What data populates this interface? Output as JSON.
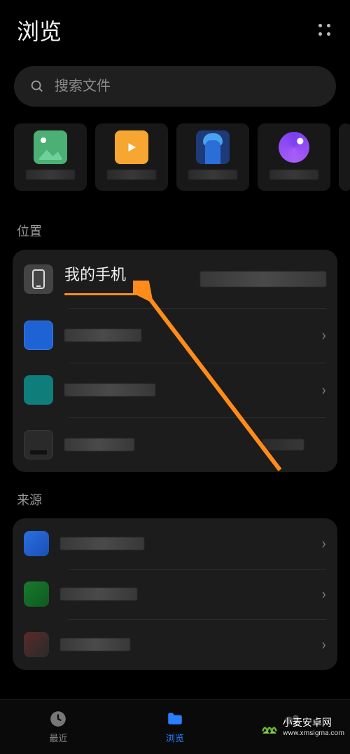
{
  "header": {
    "title": "浏览"
  },
  "search": {
    "placeholder": "搜索文件"
  },
  "sections": {
    "locations_label": "位置",
    "sources_label": "来源"
  },
  "locations": {
    "my_phone": "我的手机"
  },
  "nav": {
    "recent": "最近",
    "browse": "浏览"
  },
  "watermark": {
    "name": "小麦安卓网",
    "url": "www.xmsigma.com"
  }
}
